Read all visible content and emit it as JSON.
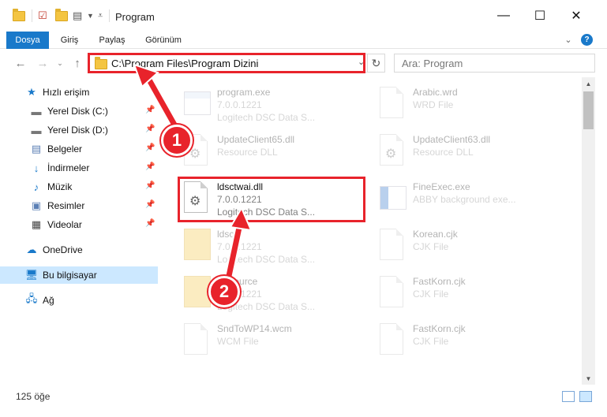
{
  "window": {
    "title": "Program",
    "minimize": "—",
    "maximize": "☐",
    "close": "✕"
  },
  "ribbon": {
    "tabs": [
      "Dosya",
      "Giriş",
      "Paylaş",
      "Görünüm"
    ],
    "collapse": "⌄",
    "help": "?"
  },
  "address": {
    "path": "C:\\Program Files\\Program Dizini",
    "search_placeholder": "Ara: Program"
  },
  "sidebar": {
    "items": [
      {
        "label": "Hızlı erişim",
        "icon": "star-icon"
      },
      {
        "label": "Yerel Disk (C:)",
        "icon": "drive-icon"
      },
      {
        "label": "Yerel Disk (D:)",
        "icon": "drive-icon"
      },
      {
        "label": "Belgeler",
        "icon": "documents-icon"
      },
      {
        "label": "İndirmeler",
        "icon": "download-icon"
      },
      {
        "label": "Müzik",
        "icon": "music-icon"
      },
      {
        "label": "Resimler",
        "icon": "pictures-icon"
      },
      {
        "label": "Videolar",
        "icon": "videos-icon"
      },
      {
        "label": "OneDrive",
        "icon": "cloud-icon"
      },
      {
        "label": "Bu bilgisayar",
        "icon": "computer-icon"
      },
      {
        "label": "Ağ",
        "icon": "network-icon"
      }
    ]
  },
  "files": [
    {
      "name": "program.exe",
      "line2": "7.0.0.1221",
      "line3": "Logitech DSC Data S...",
      "kind": "exe"
    },
    {
      "name": "Arabic.wrd",
      "line2": "WRD File",
      "line3": "",
      "kind": "doc"
    },
    {
      "name": "UpdateClient65.dll",
      "line2": "Resource DLL",
      "line3": "",
      "kind": "dll"
    },
    {
      "name": "UpdateClient63.dll",
      "line2": "Resource DLL",
      "line3": "",
      "kind": "dll"
    },
    {
      "name": "ldsctwai.dll",
      "line2": "7.0.0.1221",
      "line3": "Logitech DSC Data S...",
      "kind": "dll"
    },
    {
      "name": "FineExec.exe",
      "line2": "ABBY background exe...",
      "line3": "",
      "kind": "exe"
    },
    {
      "name": "ldsc",
      "line2": "7.0.0.1221",
      "line3": "Logitech DSC Data S...",
      "kind": "folder"
    },
    {
      "name": "Korean.cjk",
      "line2": "CJK File",
      "line3": "",
      "kind": "doc"
    },
    {
      "name": "Resource",
      "line2": "7.0.0.1221",
      "line3": "Logitech DSC Data S...",
      "kind": "folder"
    },
    {
      "name": "FastKorn.cjk",
      "line2": "CJK File",
      "line3": "",
      "kind": "doc"
    },
    {
      "name": "SndToWP14.wcm",
      "line2": "WCM File",
      "line3": "",
      "kind": "doc"
    },
    {
      "name": "FastKorn.cjk",
      "line2": "CJK File",
      "line3": "",
      "kind": "doc"
    }
  ],
  "status": {
    "count": "125 öğe"
  },
  "annotations": {
    "step1": "1",
    "step2": "2"
  },
  "colors": {
    "accent": "#1979ca",
    "highlight": "#e8232b",
    "selected": "#cce8ff"
  }
}
